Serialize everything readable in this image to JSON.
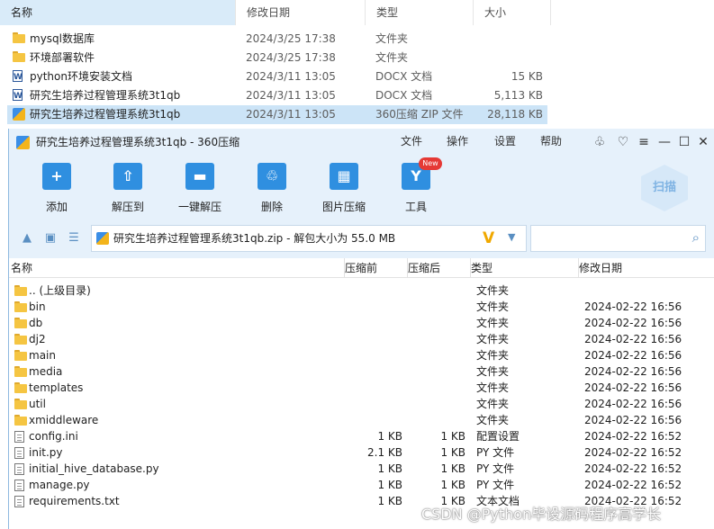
{
  "explorer": {
    "columns": {
      "name": "名称",
      "date": "修改日期",
      "type": "类型",
      "size": "大小"
    },
    "rows": [
      {
        "icon": "folder",
        "name": "mysql数据库",
        "date": "2024/3/25 17:38",
        "type": "文件夹",
        "size": ""
      },
      {
        "icon": "folder",
        "name": "环境部署软件",
        "date": "2024/3/25 17:38",
        "type": "文件夹",
        "size": ""
      },
      {
        "icon": "docx",
        "name": "python环境安装文档",
        "date": "2024/3/11 13:05",
        "type": "DOCX 文档",
        "size": "15 KB"
      },
      {
        "icon": "docx",
        "name": "研究生培养过程管理系统3t1qb",
        "date": "2024/3/11 13:05",
        "type": "DOCX 文档",
        "size": "5,113 KB"
      },
      {
        "icon": "zip",
        "name": "研究生培养过程管理系统3t1qb",
        "date": "2024/3/11 13:05",
        "type": "360压缩 ZIP 文件",
        "size": "28,118 KB"
      }
    ]
  },
  "window": {
    "title": "研究生培养过程管理系统3t1qb - 360压缩",
    "menu": [
      "文件",
      "操作",
      "设置",
      "帮助"
    ],
    "controls": {
      "skin": "♧",
      "feedback": "♡",
      "menu": "≡",
      "minimize": "—",
      "maximize": "☐",
      "close": "✕"
    }
  },
  "toolbar": {
    "items": [
      {
        "label": "添加",
        "icon": "add-icon",
        "glyph": "+"
      },
      {
        "label": "解压到",
        "icon": "extract-to-icon",
        "glyph": "⇧"
      },
      {
        "label": "一键解压",
        "icon": "one-click-extract-icon",
        "glyph": "▬"
      },
      {
        "label": "删除",
        "icon": "trash-icon",
        "glyph": "♲"
      },
      {
        "label": "图片压缩",
        "icon": "image-compress-icon",
        "glyph": "▦"
      },
      {
        "label": "工具",
        "icon": "tools-icon",
        "glyph": "Y"
      }
    ],
    "new_badge": "New",
    "scan": "扫描"
  },
  "address": {
    "text": "研究生培养过程管理系统3t1qb.zip - 解包大小为 55.0 MB",
    "v_badge": "V",
    "dropdown": "▼",
    "search_value": "",
    "search_icon": "⌕"
  },
  "list": {
    "columns": {
      "name": "名称",
      "compressed": "压缩前",
      "uncompressed": "压缩后",
      "type": "类型",
      "date": "修改日期"
    },
    "rows": [
      {
        "icon": "folder",
        "name": ".. (上级目录)",
        "compressed": "",
        "uncompressed": "",
        "type": "文件夹",
        "date": ""
      },
      {
        "icon": "folder",
        "name": "bin",
        "compressed": "",
        "uncompressed": "",
        "type": "文件夹",
        "date": "2024-02-22 16:56"
      },
      {
        "icon": "folder",
        "name": "db",
        "compressed": "",
        "uncompressed": "",
        "type": "文件夹",
        "date": "2024-02-22 16:56"
      },
      {
        "icon": "folder",
        "name": "dj2",
        "compressed": "",
        "uncompressed": "",
        "type": "文件夹",
        "date": "2024-02-22 16:56"
      },
      {
        "icon": "folder",
        "name": "main",
        "compressed": "",
        "uncompressed": "",
        "type": "文件夹",
        "date": "2024-02-22 16:56"
      },
      {
        "icon": "folder",
        "name": "media",
        "compressed": "",
        "uncompressed": "",
        "type": "文件夹",
        "date": "2024-02-22 16:56"
      },
      {
        "icon": "folder",
        "name": "templates",
        "compressed": "",
        "uncompressed": "",
        "type": "文件夹",
        "date": "2024-02-22 16:56"
      },
      {
        "icon": "folder",
        "name": "util",
        "compressed": "",
        "uncompressed": "",
        "type": "文件夹",
        "date": "2024-02-22 16:56"
      },
      {
        "icon": "folder",
        "name": "xmiddleware",
        "compressed": "",
        "uncompressed": "",
        "type": "文件夹",
        "date": "2024-02-22 16:56"
      },
      {
        "icon": "file",
        "name": "config.ini",
        "compressed": "1 KB",
        "uncompressed": "1 KB",
        "type": "配置设置",
        "date": "2024-02-22 16:52"
      },
      {
        "icon": "file",
        "name": "init.py",
        "compressed": "2.1 KB",
        "uncompressed": "1 KB",
        "type": "PY 文件",
        "date": "2024-02-22 16:52"
      },
      {
        "icon": "file",
        "name": "initial_hive_database.py",
        "compressed": "1 KB",
        "uncompressed": "1 KB",
        "type": "PY 文件",
        "date": "2024-02-22 16:52"
      },
      {
        "icon": "file",
        "name": "manage.py",
        "compressed": "1 KB",
        "uncompressed": "1 KB",
        "type": "PY 文件",
        "date": "2024-02-22 16:52"
      },
      {
        "icon": "file",
        "name": "requirements.txt",
        "compressed": "1 KB",
        "uncompressed": "1 KB",
        "type": "文本文档",
        "date": "2024-02-22 16:52"
      }
    ]
  },
  "watermark": "CSDN @Python毕设源码程序高学长"
}
